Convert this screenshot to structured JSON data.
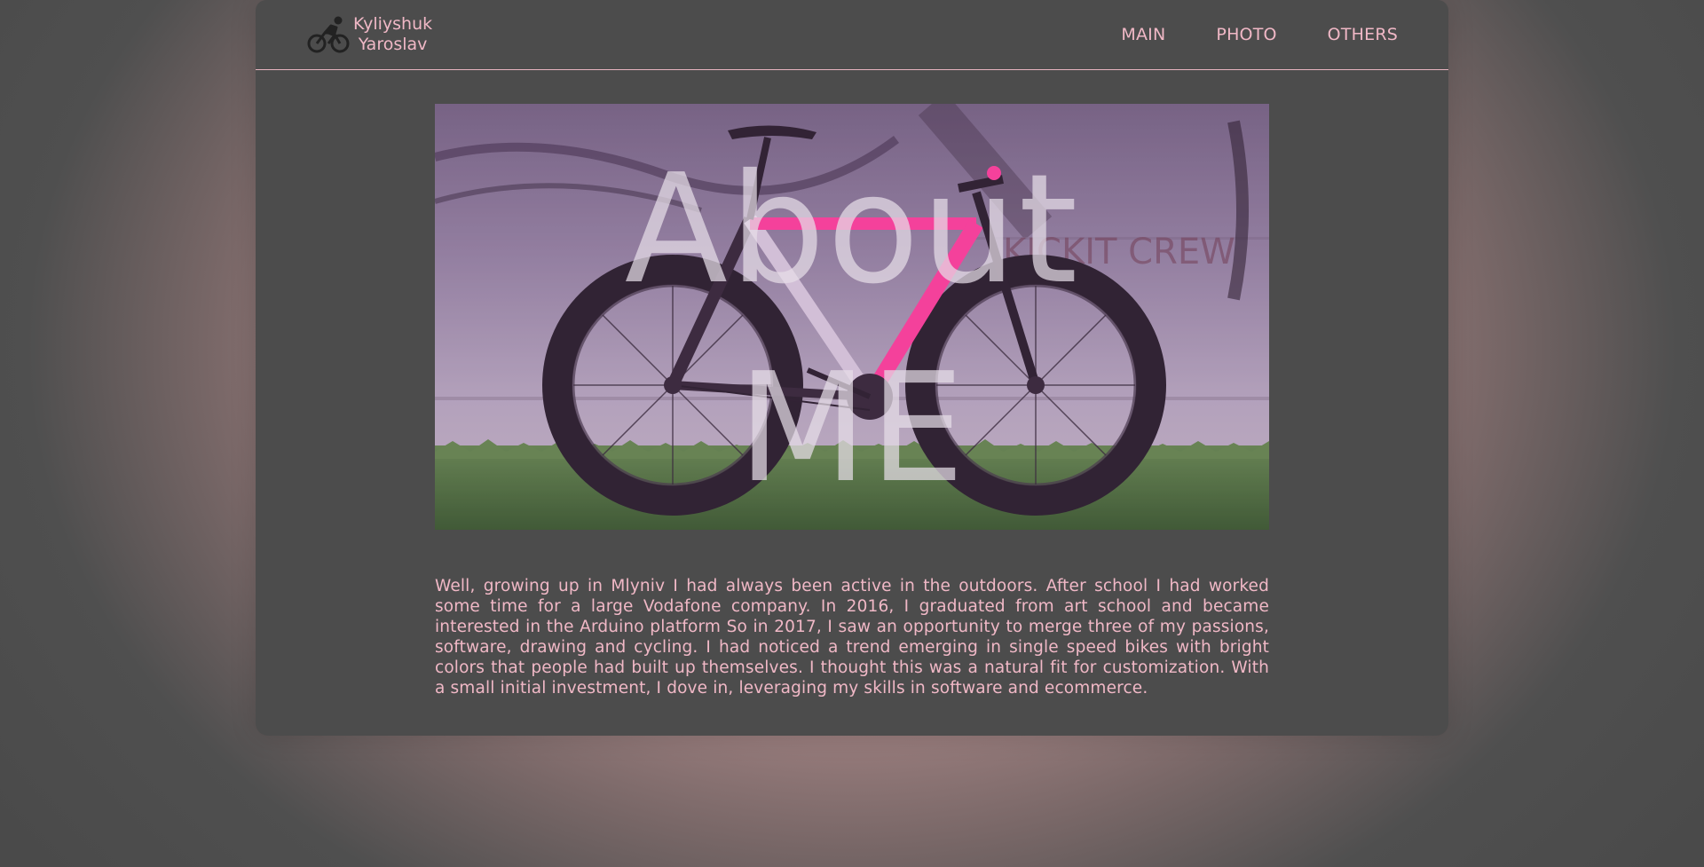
{
  "brand": {
    "icon": "cyclist-icon",
    "first_name": "Kyliyshuk",
    "last_name": "Yaroslav"
  },
  "nav": {
    "items": [
      {
        "label": "MAIN"
      },
      {
        "label": "PHOTO"
      },
      {
        "label": "OTHERS"
      }
    ]
  },
  "hero": {
    "image": "bicycle-photo",
    "title_line1": "About",
    "title_line2": "ME"
  },
  "about": {
    "text": "Well, growing up in Mlyniv I had always been active in the outdoors. After school I had worked some time for a large Vodafone company. In 2016, I graduated from art school and became interested in the Arduino platform So in 2017, I saw an opportunity to merge three of my passions, software, drawing and cycling. I had noticed a trend emerging in single speed bikes with bright colors that people had built up themselves. I thought this was a natural fit for customization. With a small initial investment, I dove in, leveraging my skills in software and ecommerce."
  },
  "colors": {
    "accent": "#f0b8c6",
    "card_background": "#4c4c4c",
    "page_glow": "#b89595"
  }
}
